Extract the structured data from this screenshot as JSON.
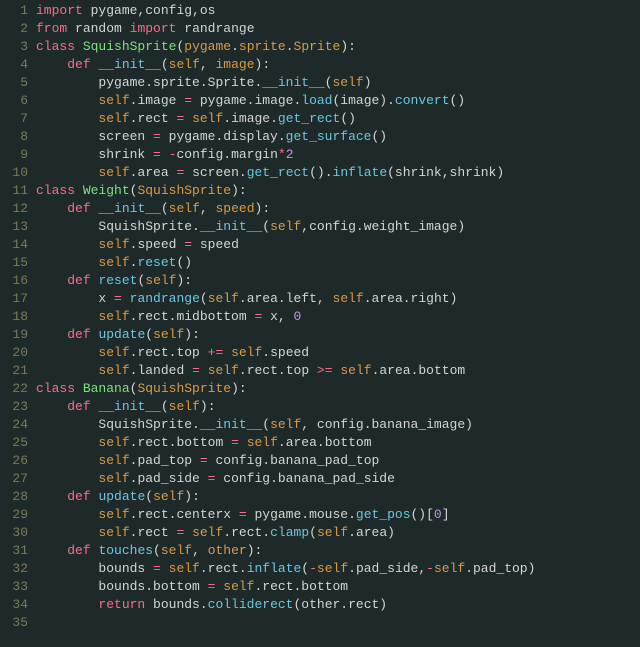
{
  "lines": [
    {
      "n": "1",
      "html": "<span class='kw'>import</span> <span class='str'>pygame,config,os</span>"
    },
    {
      "n": "2",
      "html": "<span class='kw'>from</span> <span class='str'>random</span> <span class='kw'>import</span> <span class='str'>randrange</span>"
    },
    {
      "n": "3",
      "html": "<span class='kw'>class</span> <span class='cls'>SquishSprite</span><span class='pun'>(</span><span class='self'>pygame</span><span class='pun'>.</span><span class='self'>sprite</span><span class='pun'>.</span><span class='self'>Sprite</span><span class='pun'>):</span>"
    },
    {
      "n": "4",
      "html": "    <span class='kw'>def</span> <span class='fn'>__init__</span><span class='pun'>(</span><span class='self'>self</span><span class='pun'>, </span><span class='self'>image</span><span class='pun'>):</span>"
    },
    {
      "n": "5",
      "html": "        <span class='str'>pygame.sprite.Sprite.</span><span class='fn'>__init__</span><span class='pun'>(</span><span class='self'>self</span><span class='pun'>)</span>"
    },
    {
      "n": "6",
      "html": "        <span class='self'>self</span><span class='pun'>.image </span><span class='op'>=</span><span class='pun'> pygame.image.</span><span class='fn'>load</span><span class='pun'>(image).</span><span class='fn'>convert</span><span class='pun'>()</span>"
    },
    {
      "n": "7",
      "html": "        <span class='self'>self</span><span class='pun'>.rect </span><span class='op'>=</span><span class='pun'> </span><span class='self'>self</span><span class='pun'>.image.</span><span class='fn'>get_rect</span><span class='pun'>()</span>"
    },
    {
      "n": "8",
      "html": "        <span class='pun'>screen </span><span class='op'>=</span><span class='pun'> pygame.display.</span><span class='fn'>get_surface</span><span class='pun'>()</span>"
    },
    {
      "n": "9",
      "html": "        <span class='pun'>shrink </span><span class='op'>=</span><span class='pun'> </span><span class='op'>-</span><span class='pun'>config.margin</span><span class='op'>*</span><span class='num'>2</span>"
    },
    {
      "n": "10",
      "html": "        <span class='self'>self</span><span class='pun'>.area </span><span class='op'>=</span><span class='pun'> screen.</span><span class='fn'>get_rect</span><span class='pun'>().</span><span class='fn'>inflate</span><span class='pun'>(shrink,shrink)</span>"
    },
    {
      "n": "11",
      "html": "<span class='kw'>class</span> <span class='cls'>Weight</span><span class='pun'>(</span><span class='self'>SquishSprite</span><span class='pun'>):</span>"
    },
    {
      "n": "12",
      "html": "    <span class='kw'>def</span> <span class='fn'>__init__</span><span class='pun'>(</span><span class='self'>self</span><span class='pun'>, </span><span class='self'>speed</span><span class='pun'>):</span>"
    },
    {
      "n": "13",
      "html": "        <span class='str'>SquishSprite.</span><span class='fn'>__init__</span><span class='pun'>(</span><span class='self'>self</span><span class='pun'>,config.weight_image)</span>"
    },
    {
      "n": "14",
      "html": "        <span class='self'>self</span><span class='pun'>.speed </span><span class='op'>=</span><span class='pun'> speed</span>"
    },
    {
      "n": "15",
      "html": "        <span class='self'>self</span><span class='pun'>.</span><span class='fn'>reset</span><span class='pun'>()</span>"
    },
    {
      "n": "16",
      "html": "    <span class='kw'>def</span> <span class='fn'>reset</span><span class='pun'>(</span><span class='self'>self</span><span class='pun'>):</span>"
    },
    {
      "n": "17",
      "html": "        <span class='pun'>x </span><span class='op'>=</span><span class='pun'> </span><span class='fn'>randrange</span><span class='pun'>(</span><span class='self'>self</span><span class='pun'>.area.left, </span><span class='self'>self</span><span class='pun'>.area.right)</span>"
    },
    {
      "n": "18",
      "html": "        <span class='self'>self</span><span class='pun'>.rect.midbottom </span><span class='op'>=</span><span class='pun'> x, </span><span class='num'>0</span>"
    },
    {
      "n": "19",
      "html": "    <span class='kw'>def</span> <span class='fn'>update</span><span class='pun'>(</span><span class='self'>self</span><span class='pun'>):</span>"
    },
    {
      "n": "20",
      "html": "        <span class='self'>self</span><span class='pun'>.rect.top </span><span class='op'>+=</span><span class='pun'> </span><span class='self'>self</span><span class='pun'>.speed</span>"
    },
    {
      "n": "21",
      "html": "        <span class='self'>self</span><span class='pun'>.landed </span><span class='op'>=</span><span class='pun'> </span><span class='self'>self</span><span class='pun'>.rect.top </span><span class='op'>&gt;=</span><span class='pun'> </span><span class='self'>self</span><span class='pun'>.area.bottom</span>"
    },
    {
      "n": "22",
      "html": "<span class='kw'>class</span> <span class='cls'>Banana</span><span class='pun'>(</span><span class='self'>SquishSprite</span><span class='pun'>):</span>"
    },
    {
      "n": "23",
      "html": "    <span class='kw'>def</span> <span class='fn'>__init__</span><span class='pun'>(</span><span class='self'>self</span><span class='pun'>):</span>"
    },
    {
      "n": "24",
      "html": "        <span class='str'>SquishSprite.</span><span class='fn'>__init__</span><span class='pun'>(</span><span class='self'>self</span><span class='pun'>, config.banana_image)</span>"
    },
    {
      "n": "25",
      "html": "        <span class='self'>self</span><span class='pun'>.rect.bottom </span><span class='op'>=</span><span class='pun'> </span><span class='self'>self</span><span class='pun'>.area.bottom</span>"
    },
    {
      "n": "26",
      "html": "        <span class='self'>self</span><span class='pun'>.pad_top </span><span class='op'>=</span><span class='pun'> config.banana_pad_top</span>"
    },
    {
      "n": "27",
      "html": "        <span class='self'>self</span><span class='pun'>.pad_side </span><span class='op'>=</span><span class='pun'> config.banana_pad_side</span>"
    },
    {
      "n": "28",
      "html": "    <span class='kw'>def</span> <span class='fn'>update</span><span class='pun'>(</span><span class='self'>self</span><span class='pun'>):</span>"
    },
    {
      "n": "29",
      "html": "        <span class='self'>self</span><span class='pun'>.rect.centerx </span><span class='op'>=</span><span class='pun'> pygame.mouse.</span><span class='fn'>get_pos</span><span class='pun'>()[</span><span class='num'>0</span><span class='pun'>]</span>"
    },
    {
      "n": "30",
      "html": "        <span class='self'>self</span><span class='pun'>.rect </span><span class='op'>=</span><span class='pun'> </span><span class='self'>self</span><span class='pun'>.rect.</span><span class='fn'>clamp</span><span class='pun'>(</span><span class='self'>self</span><span class='pun'>.area)</span>"
    },
    {
      "n": "31",
      "html": "    <span class='kw'>def</span> <span class='fn'>touches</span><span class='pun'>(</span><span class='self'>self</span><span class='pun'>, </span><span class='self'>other</span><span class='pun'>):</span>"
    },
    {
      "n": "32",
      "html": "        <span class='pun'>bounds </span><span class='op'>=</span><span class='pun'> </span><span class='self'>self</span><span class='pun'>.rect.</span><span class='fn'>inflate</span><span class='pun'>(</span><span class='op'>-</span><span class='self'>self</span><span class='pun'>.pad_side,</span><span class='op'>-</span><span class='self'>self</span><span class='pun'>.pad_top)</span>"
    },
    {
      "n": "33",
      "html": "        <span class='pun'>bounds.bottom </span><span class='op'>=</span><span class='pun'> </span><span class='self'>self</span><span class='pun'>.rect.bottom</span>"
    },
    {
      "n": "34",
      "html": "        <span class='kw'>return</span><span class='pun'> bounds.</span><span class='fn'>colliderect</span><span class='pun'>(other.rect)</span>"
    },
    {
      "n": "35",
      "html": ""
    }
  ]
}
